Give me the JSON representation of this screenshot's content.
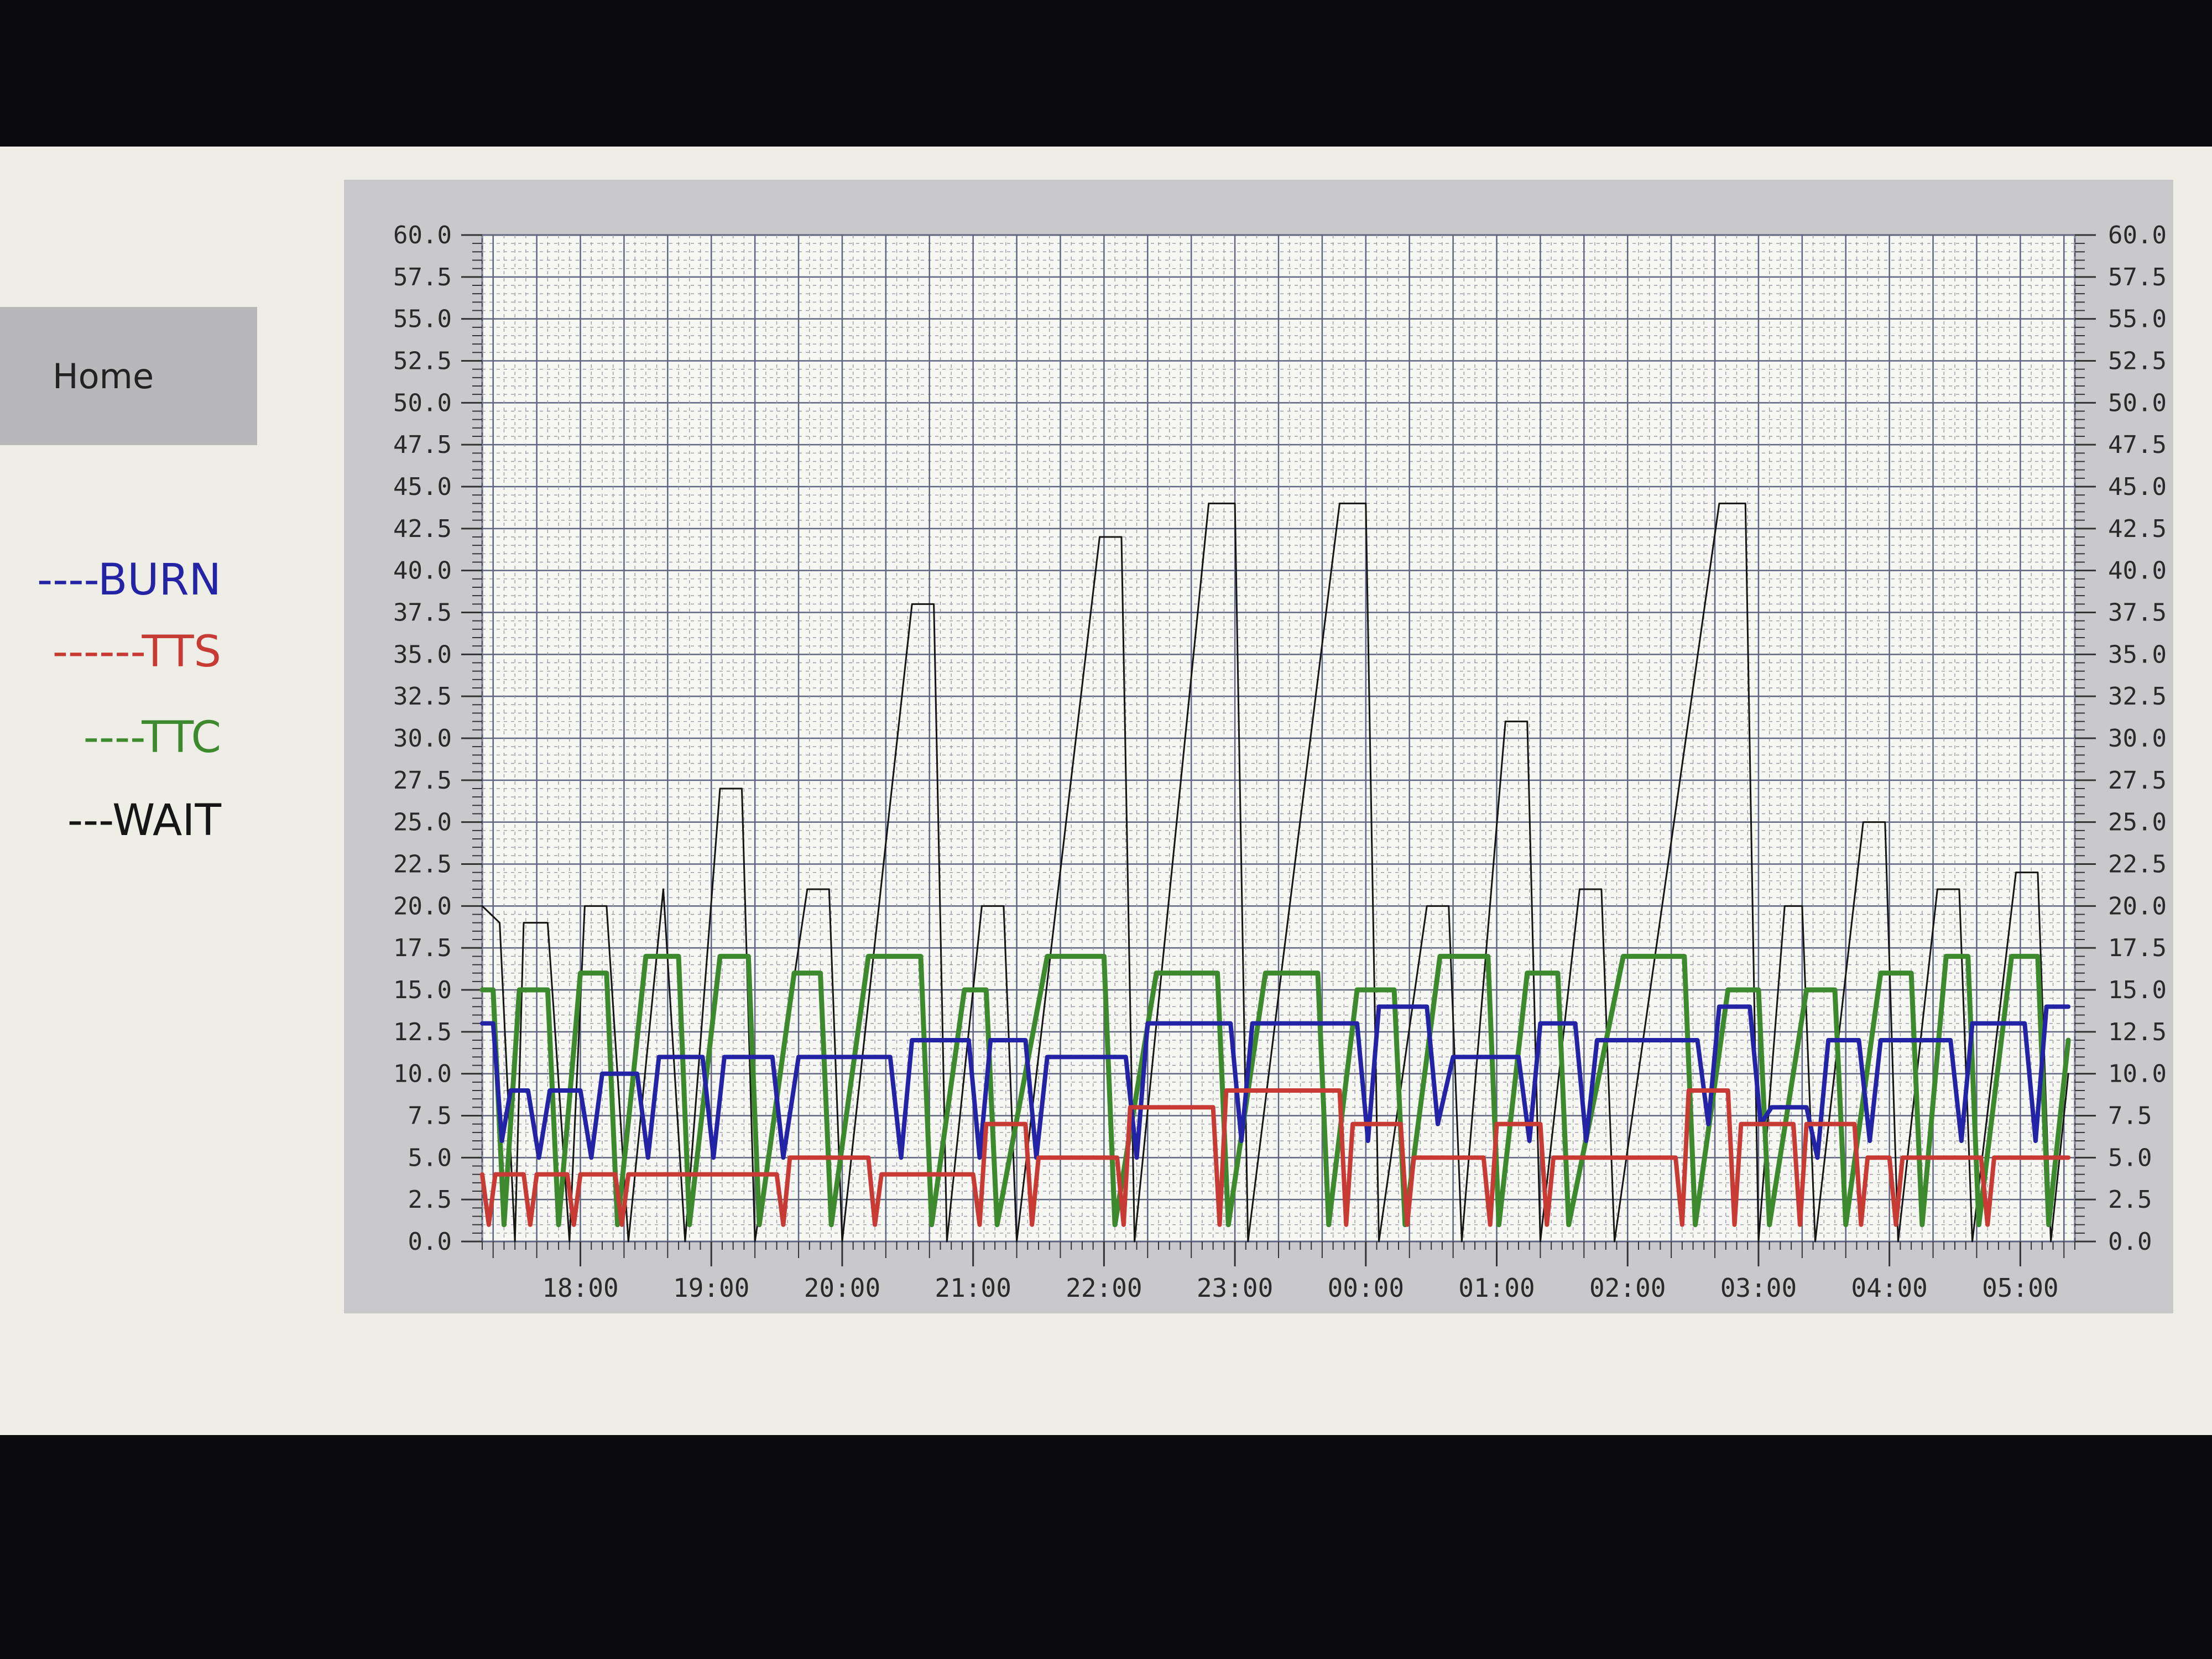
{
  "nav": {
    "home_label": "Home"
  },
  "legend": [
    {
      "label": "----BURN",
      "color": "#2323a6"
    },
    {
      "label": "------TTS",
      "color": "#c83a34"
    },
    {
      "label": "----TTC",
      "color": "#3d8a2e"
    },
    {
      "label": "---WAIT",
      "color": "#151515"
    }
  ],
  "chart_data": {
    "type": "line",
    "grid": true,
    "y_left": {
      "min": 0,
      "max": 60,
      "ticks": [
        "0.0",
        "2.5",
        "5.0",
        "7.5",
        "10.0",
        "12.5",
        "15.0",
        "17.5",
        "20.0",
        "22.5",
        "25.0",
        "27.5",
        "30.0",
        "32.5",
        "35.0",
        "37.5",
        "40.0",
        "42.5",
        "45.0",
        "47.5",
        "50.0",
        "52.5",
        "55.0",
        "57.5",
        "60.0"
      ]
    },
    "y_right": {
      "min": 0,
      "max": 60,
      "ticks": [
        "0.0",
        "2.5",
        "5.0",
        "7.5",
        "10.0",
        "12.5",
        "15.0",
        "17.5",
        "20.0",
        "22.5",
        "25.0",
        "27.5",
        "30.0",
        "32.5",
        "35.0",
        "37.5",
        "40.0",
        "42.5",
        "45.0",
        "47.5",
        "50.0",
        "52.5",
        "55.0",
        "57.5",
        "60.0"
      ]
    },
    "x_range": [
      "17:15",
      "05:25"
    ],
    "x_ticks": [
      "18:00",
      "19:00",
      "20:00",
      "21:00",
      "22:00",
      "23:00",
      "00:00",
      "01:00",
      "02:00",
      "03:00",
      "04:00",
      "05:00"
    ],
    "series": [
      {
        "name": "WAIT",
        "color": "#151515",
        "points": [
          [
            "17:15",
            20
          ],
          [
            "17:23",
            19
          ],
          [
            "17:30",
            0
          ],
          [
            "17:34",
            19
          ],
          [
            "17:45",
            19
          ],
          [
            "17:55",
            0
          ],
          [
            "18:02",
            20
          ],
          [
            "18:12",
            20
          ],
          [
            "18:22",
            0
          ],
          [
            "18:38",
            21
          ],
          [
            "18:48",
            0
          ],
          [
            "19:04",
            27
          ],
          [
            "19:14",
            27
          ],
          [
            "19:20",
            0
          ],
          [
            "19:44",
            21
          ],
          [
            "19:54",
            21
          ],
          [
            "20:00",
            0
          ],
          [
            "20:32",
            38
          ],
          [
            "20:42",
            38
          ],
          [
            "20:48",
            0
          ],
          [
            "21:04",
            20
          ],
          [
            "21:14",
            20
          ],
          [
            "21:20",
            0
          ],
          [
            "21:58",
            42
          ],
          [
            "22:08",
            42
          ],
          [
            "22:14",
            0
          ],
          [
            "22:48",
            44
          ],
          [
            "23:00",
            44
          ],
          [
            "23:06",
            0
          ],
          [
            "23:48",
            44
          ],
          [
            "24:00",
            44
          ],
          [
            "24:06",
            0
          ],
          [
            "24:28",
            20
          ],
          [
            "24:38",
            20
          ],
          [
            "24:44",
            0
          ],
          [
            "25:04",
            31
          ],
          [
            "25:14",
            31
          ],
          [
            "25:20",
            0
          ],
          [
            "25:38",
            21
          ],
          [
            "25:48",
            21
          ],
          [
            "25:54",
            0
          ],
          [
            "26:42",
            44
          ],
          [
            "26:54",
            44
          ],
          [
            "27:00",
            0
          ],
          [
            "27:12",
            20
          ],
          [
            "27:20",
            20
          ],
          [
            "27:26",
            0
          ],
          [
            "27:48",
            25
          ],
          [
            "27:58",
            25
          ],
          [
            "28:04",
            0
          ],
          [
            "28:22",
            21
          ],
          [
            "28:32",
            21
          ],
          [
            "28:38",
            0
          ],
          [
            "28:58",
            22
          ],
          [
            "29:08",
            22
          ],
          [
            "29:14",
            0
          ],
          [
            "29:22",
            10
          ]
        ]
      },
      {
        "name": "TTC",
        "color": "#3d8a2e",
        "points": [
          [
            "17:15",
            15
          ],
          [
            "17:20",
            15
          ],
          [
            "17:25",
            1
          ],
          [
            "17:32",
            15
          ],
          [
            "17:45",
            15
          ],
          [
            "17:50",
            1
          ],
          [
            "18:00",
            16
          ],
          [
            "18:12",
            16
          ],
          [
            "18:17",
            1
          ],
          [
            "18:30",
            17
          ],
          [
            "18:45",
            17
          ],
          [
            "18:50",
            1
          ],
          [
            "19:04",
            17
          ],
          [
            "19:17",
            17
          ],
          [
            "19:22",
            1
          ],
          [
            "19:38",
            16
          ],
          [
            "19:50",
            16
          ],
          [
            "19:55",
            1
          ],
          [
            "20:12",
            17
          ],
          [
            "20:36",
            17
          ],
          [
            "20:41",
            1
          ],
          [
            "20:56",
            15
          ],
          [
            "21:06",
            15
          ],
          [
            "21:11",
            1
          ],
          [
            "21:34",
            17
          ],
          [
            "22:00",
            17
          ],
          [
            "22:05",
            1
          ],
          [
            "22:24",
            16
          ],
          [
            "22:52",
            16
          ],
          [
            "22:57",
            1
          ],
          [
            "23:14",
            16
          ],
          [
            "23:38",
            16
          ],
          [
            "23:43",
            1
          ],
          [
            "23:56",
            15
          ],
          [
            "24:13",
            15
          ],
          [
            "24:18",
            1
          ],
          [
            "24:34",
            17
          ],
          [
            "24:56",
            17
          ],
          [
            "25:01",
            1
          ],
          [
            "25:14",
            16
          ],
          [
            "25:28",
            16
          ],
          [
            "25:33",
            1
          ],
          [
            "25:58",
            17
          ],
          [
            "26:26",
            17
          ],
          [
            "26:31",
            1
          ],
          [
            "26:46",
            15
          ],
          [
            "27:00",
            15
          ],
          [
            "27:05",
            1
          ],
          [
            "27:22",
            15
          ],
          [
            "27:35",
            15
          ],
          [
            "27:40",
            1
          ],
          [
            "27:56",
            16
          ],
          [
            "28:10",
            16
          ],
          [
            "28:15",
            1
          ],
          [
            "28:26",
            17
          ],
          [
            "28:36",
            17
          ],
          [
            "28:41",
            1
          ],
          [
            "28:56",
            17
          ],
          [
            "29:08",
            17
          ],
          [
            "29:13",
            1
          ],
          [
            "29:22",
            12
          ]
        ]
      },
      {
        "name": "BURN",
        "color": "#2323a6",
        "points": [
          [
            "17:15",
            13
          ],
          [
            "17:20",
            13
          ],
          [
            "17:24",
            6
          ],
          [
            "17:28",
            9
          ],
          [
            "17:36",
            9
          ],
          [
            "17:41",
            5
          ],
          [
            "17:46",
            9
          ],
          [
            "18:00",
            9
          ],
          [
            "18:05",
            5
          ],
          [
            "18:10",
            10
          ],
          [
            "18:26",
            10
          ],
          [
            "18:31",
            5
          ],
          [
            "18:36",
            11
          ],
          [
            "18:56",
            11
          ],
          [
            "19:01",
            5
          ],
          [
            "19:06",
            11
          ],
          [
            "19:28",
            11
          ],
          [
            "19:33",
            5
          ],
          [
            "19:40",
            11
          ],
          [
            "20:22",
            11
          ],
          [
            "20:27",
            5
          ],
          [
            "20:32",
            12
          ],
          [
            "20:58",
            12
          ],
          [
            "21:03",
            5
          ],
          [
            "21:08",
            12
          ],
          [
            "21:24",
            12
          ],
          [
            "21:29",
            5
          ],
          [
            "21:34",
            11
          ],
          [
            "22:10",
            11
          ],
          [
            "22:15",
            5
          ],
          [
            "22:20",
            13
          ],
          [
            "22:58",
            13
          ],
          [
            "23:03",
            6
          ],
          [
            "23:08",
            13
          ],
          [
            "23:56",
            13
          ],
          [
            "24:01",
            6
          ],
          [
            "24:06",
            14
          ],
          [
            "24:28",
            14
          ],
          [
            "24:33",
            7
          ],
          [
            "24:40",
            11
          ],
          [
            "25:10",
            11
          ],
          [
            "25:15",
            6
          ],
          [
            "25:20",
            13
          ],
          [
            "25:36",
            13
          ],
          [
            "25:41",
            6
          ],
          [
            "25:46",
            12
          ],
          [
            "26:32",
            12
          ],
          [
            "26:37",
            7
          ],
          [
            "26:42",
            14
          ],
          [
            "26:56",
            14
          ],
          [
            "27:01",
            7
          ],
          [
            "27:06",
            8
          ],
          [
            "27:22",
            8
          ],
          [
            "27:27",
            5
          ],
          [
            "27:32",
            12
          ],
          [
            "27:46",
            12
          ],
          [
            "27:51",
            6
          ],
          [
            "27:56",
            12
          ],
          [
            "28:28",
            12
          ],
          [
            "28:33",
            6
          ],
          [
            "28:38",
            13
          ],
          [
            "29:02",
            13
          ],
          [
            "29:07",
            6
          ],
          [
            "29:12",
            14
          ],
          [
            "29:22",
            14
          ]
        ]
      },
      {
        "name": "TTS",
        "color": "#c83a34",
        "points": [
          [
            "17:15",
            4
          ],
          [
            "17:18",
            1
          ],
          [
            "17:21",
            4
          ],
          [
            "17:34",
            4
          ],
          [
            "17:37",
            1
          ],
          [
            "17:40",
            4
          ],
          [
            "17:54",
            4
          ],
          [
            "17:57",
            1
          ],
          [
            "18:00",
            4
          ],
          [
            "18:16",
            4
          ],
          [
            "18:19",
            1
          ],
          [
            "18:22",
            4
          ],
          [
            "19:30",
            4
          ],
          [
            "19:33",
            1
          ],
          [
            "19:36",
            5
          ],
          [
            "20:12",
            5
          ],
          [
            "20:15",
            1
          ],
          [
            "20:18",
            4
          ],
          [
            "21:00",
            4
          ],
          [
            "21:03",
            1
          ],
          [
            "21:06",
            7
          ],
          [
            "21:24",
            7
          ],
          [
            "21:27",
            1
          ],
          [
            "21:30",
            5
          ],
          [
            "22:06",
            5
          ],
          [
            "22:09",
            1
          ],
          [
            "22:12",
            8
          ],
          [
            "22:50",
            8
          ],
          [
            "22:53",
            1
          ],
          [
            "22:56",
            9
          ],
          [
            "23:48",
            9
          ],
          [
            "23:51",
            1
          ],
          [
            "23:54",
            7
          ],
          [
            "24:16",
            7
          ],
          [
            "24:19",
            1
          ],
          [
            "24:22",
            5
          ],
          [
            "24:54",
            5
          ],
          [
            "24:57",
            1
          ],
          [
            "25:00",
            7
          ],
          [
            "25:20",
            7
          ],
          [
            "25:23",
            1
          ],
          [
            "25:26",
            5
          ],
          [
            "26:22",
            5
          ],
          [
            "26:25",
            1
          ],
          [
            "26:28",
            9
          ],
          [
            "26:46",
            9
          ],
          [
            "26:49",
            1
          ],
          [
            "26:52",
            7
          ],
          [
            "27:16",
            7
          ],
          [
            "27:19",
            1
          ],
          [
            "27:22",
            7
          ],
          [
            "27:44",
            7
          ],
          [
            "27:47",
            1
          ],
          [
            "27:50",
            5
          ],
          [
            "28:00",
            5
          ],
          [
            "28:03",
            1
          ],
          [
            "28:06",
            5
          ],
          [
            "28:42",
            5
          ],
          [
            "28:45",
            1
          ],
          [
            "28:48",
            5
          ],
          [
            "29:22",
            5
          ]
        ]
      }
    ]
  }
}
